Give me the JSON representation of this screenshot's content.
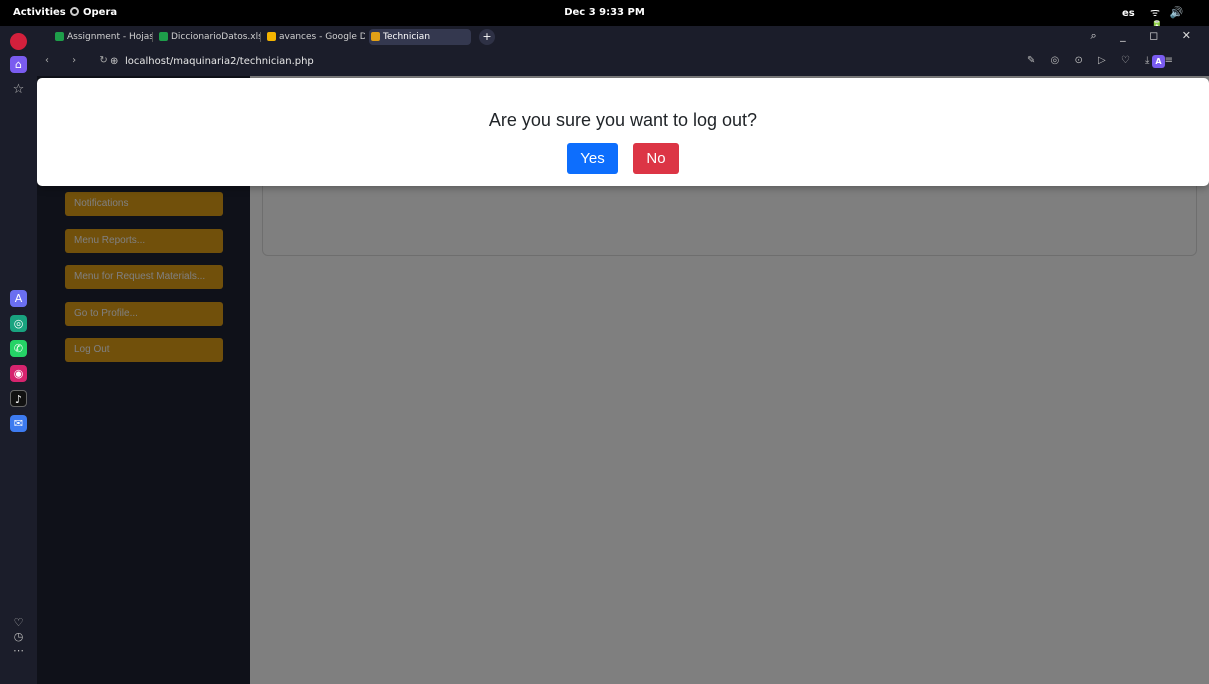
{
  "system_bar": {
    "activities": "Activities",
    "app_name": "Opera",
    "clock": "Dec 3  9:33 PM",
    "language": "es",
    "status_icons": "ᯤ 🔊 🔋"
  },
  "browser": {
    "tabs": [
      {
        "label": "Assignment - Hojas",
        "favicon_color": "#1e9e4a",
        "active": false
      },
      {
        "label": "DiccionarioDatos.xls",
        "favicon_color": "#1e9e4a",
        "active": false
      },
      {
        "label": "avances - Google Dri",
        "favicon_color": "#f4b400",
        "active": false
      },
      {
        "label": "Technician",
        "favicon_color": "#e2a016",
        "active": true
      }
    ],
    "new_tab": "+",
    "window_controls": "⌕ _ ◻ ✕",
    "nav_buttons": "‹ › ↻",
    "url": "localhost/maquinaria2/technician.php",
    "toolbar_icons": "✎ ◎ ⊙ ▷ ♡ ⤓ ≡",
    "profile_initial": "A"
  },
  "opera_sidebar": {
    "top_icons": [
      "opera-logo",
      "home",
      "star"
    ],
    "app_icons": [
      "aria",
      "chatgpt",
      "whatsapp",
      "instagram",
      "tiktok",
      "messenger"
    ],
    "bottom_icons": "♡ ◷ ⋯"
  },
  "app_nav": {
    "items": [
      {
        "label": "Notifications"
      },
      {
        "label": "Menu Reports..."
      },
      {
        "label": "Menu for Request Materials..."
      },
      {
        "label": "Go to Profile..."
      },
      {
        "label": "Log Out"
      }
    ]
  },
  "colors": {
    "nav_button": "#e2a016",
    "yes_button": "#0d6efd",
    "no_button": "#dc3545",
    "sidebar_bg": "#1e2233"
  },
  "modal": {
    "message": "Are you sure you want to log out?",
    "yes_label": "Yes",
    "no_label": "No"
  }
}
